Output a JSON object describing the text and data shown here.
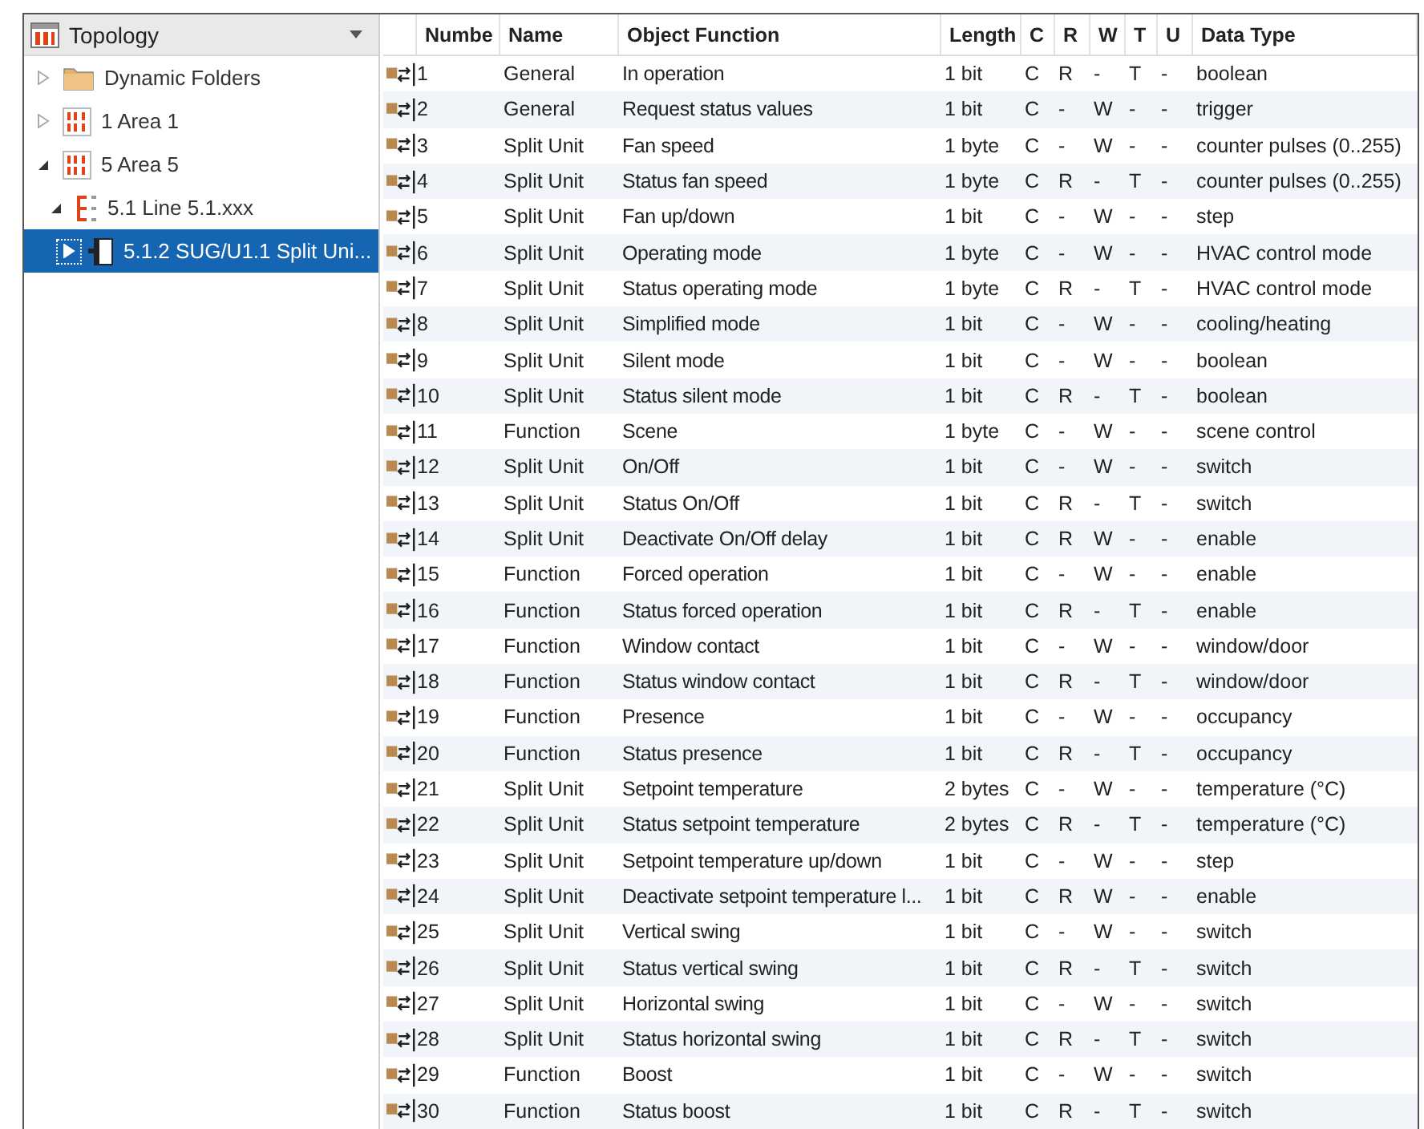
{
  "panel": {
    "title": "Topology"
  },
  "tree": [
    {
      "label": "Dynamic Folders",
      "kind": "folder",
      "expanded": false,
      "selected": false
    },
    {
      "label": "1 Area 1",
      "kind": "area",
      "expanded": false,
      "selected": false
    },
    {
      "label": "5 Area 5",
      "kind": "area",
      "expanded": true,
      "selected": false,
      "children": [
        {
          "label": "5.1 Line 5.1.xxx",
          "kind": "line",
          "expanded": true,
          "selected": false,
          "children": [
            {
              "label": "5.1.2 SUG/U1.1 Split Uni...",
              "kind": "device",
              "expanded": false,
              "selected": true
            }
          ]
        }
      ]
    }
  ],
  "table": {
    "columns": [
      "Numbe",
      "Name",
      "Object Function",
      "Length",
      "C",
      "R",
      "W",
      "T",
      "U",
      "Data Type"
    ],
    "rows": [
      {
        "number": "1",
        "name": "General",
        "object_function": "In operation",
        "length": "1 bit",
        "c": "C",
        "r": "R",
        "w": "-",
        "t": "T",
        "u": "-",
        "data_type": "boolean"
      },
      {
        "number": "2",
        "name": "General",
        "object_function": "Request status values",
        "length": "1 bit",
        "c": "C",
        "r": "-",
        "w": "W",
        "t": "-",
        "u": "-",
        "data_type": "trigger"
      },
      {
        "number": "3",
        "name": "Split Unit",
        "object_function": "Fan speed",
        "length": "1 byte",
        "c": "C",
        "r": "-",
        "w": "W",
        "t": "-",
        "u": "-",
        "data_type": "counter pulses (0..255)"
      },
      {
        "number": "4",
        "name": "Split Unit",
        "object_function": "Status fan speed",
        "length": "1 byte",
        "c": "C",
        "r": "R",
        "w": "-",
        "t": "T",
        "u": "-",
        "data_type": "counter pulses (0..255)"
      },
      {
        "number": "5",
        "name": "Split Unit",
        "object_function": "Fan up/down",
        "length": "1 bit",
        "c": "C",
        "r": "-",
        "w": "W",
        "t": "-",
        "u": "-",
        "data_type": "step"
      },
      {
        "number": "6",
        "name": "Split Unit",
        "object_function": "Operating mode",
        "length": "1 byte",
        "c": "C",
        "r": "-",
        "w": "W",
        "t": "-",
        "u": "-",
        "data_type": "HVAC control mode"
      },
      {
        "number": "7",
        "name": "Split Unit",
        "object_function": "Status operating mode",
        "length": "1 byte",
        "c": "C",
        "r": "R",
        "w": "-",
        "t": "T",
        "u": "-",
        "data_type": "HVAC control mode"
      },
      {
        "number": "8",
        "name": "Split Unit",
        "object_function": "Simplified mode",
        "length": "1 bit",
        "c": "C",
        "r": "-",
        "w": "W",
        "t": "-",
        "u": "-",
        "data_type": "cooling/heating"
      },
      {
        "number": "9",
        "name": "Split Unit",
        "object_function": "Silent mode",
        "length": "1 bit",
        "c": "C",
        "r": "-",
        "w": "W",
        "t": "-",
        "u": "-",
        "data_type": "boolean"
      },
      {
        "number": "10",
        "name": "Split Unit",
        "object_function": "Status silent mode",
        "length": "1 bit",
        "c": "C",
        "r": "R",
        "w": "-",
        "t": "T",
        "u": "-",
        "data_type": "boolean"
      },
      {
        "number": "11",
        "name": "Function",
        "object_function": "Scene",
        "length": "1 byte",
        "c": "C",
        "r": "-",
        "w": "W",
        "t": "-",
        "u": "-",
        "data_type": "scene control"
      },
      {
        "number": "12",
        "name": "Split Unit",
        "object_function": "On/Off",
        "length": "1 bit",
        "c": "C",
        "r": "-",
        "w": "W",
        "t": "-",
        "u": "-",
        "data_type": "switch"
      },
      {
        "number": "13",
        "name": "Split Unit",
        "object_function": "Status On/Off",
        "length": "1 bit",
        "c": "C",
        "r": "R",
        "w": "-",
        "t": "T",
        "u": "-",
        "data_type": "switch"
      },
      {
        "number": "14",
        "name": "Split Unit",
        "object_function": "Deactivate On/Off delay",
        "length": "1 bit",
        "c": "C",
        "r": "R",
        "w": "W",
        "t": "-",
        "u": "-",
        "data_type": "enable"
      },
      {
        "number": "15",
        "name": "Function",
        "object_function": "Forced operation",
        "length": "1 bit",
        "c": "C",
        "r": "-",
        "w": "W",
        "t": "-",
        "u": "-",
        "data_type": "enable"
      },
      {
        "number": "16",
        "name": "Function",
        "object_function": "Status forced operation",
        "length": "1 bit",
        "c": "C",
        "r": "R",
        "w": "-",
        "t": "T",
        "u": "-",
        "data_type": "enable"
      },
      {
        "number": "17",
        "name": "Function",
        "object_function": "Window contact",
        "length": "1 bit",
        "c": "C",
        "r": "-",
        "w": "W",
        "t": "-",
        "u": "-",
        "data_type": "window/door"
      },
      {
        "number": "18",
        "name": "Function",
        "object_function": "Status window contact",
        "length": "1 bit",
        "c": "C",
        "r": "R",
        "w": "-",
        "t": "T",
        "u": "-",
        "data_type": "window/door"
      },
      {
        "number": "19",
        "name": "Function",
        "object_function": "Presence",
        "length": "1 bit",
        "c": "C",
        "r": "-",
        "w": "W",
        "t": "-",
        "u": "-",
        "data_type": "occupancy"
      },
      {
        "number": "20",
        "name": "Function",
        "object_function": "Status presence",
        "length": "1 bit",
        "c": "C",
        "r": "R",
        "w": "-",
        "t": "T",
        "u": "-",
        "data_type": "occupancy"
      },
      {
        "number": "21",
        "name": "Split Unit",
        "object_function": "Setpoint temperature",
        "length": "2 bytes",
        "c": "C",
        "r": "-",
        "w": "W",
        "t": "-",
        "u": "-",
        "data_type": "temperature (°C)"
      },
      {
        "number": "22",
        "name": "Split Unit",
        "object_function": "Status setpoint temperature",
        "length": "2 bytes",
        "c": "C",
        "r": "R",
        "w": "-",
        "t": "T",
        "u": "-",
        "data_type": "temperature (°C)"
      },
      {
        "number": "23",
        "name": "Split Unit",
        "object_function": "Setpoint temperature up/down",
        "length": "1 bit",
        "c": "C",
        "r": "-",
        "w": "W",
        "t": "-",
        "u": "-",
        "data_type": "step"
      },
      {
        "number": "24",
        "name": "Split Unit",
        "object_function": "Deactivate setpoint temperature l...",
        "length": "1 bit",
        "c": "C",
        "r": "R",
        "w": "W",
        "t": "-",
        "u": "-",
        "data_type": "enable"
      },
      {
        "number": "25",
        "name": "Split Unit",
        "object_function": "Vertical swing",
        "length": "1 bit",
        "c": "C",
        "r": "-",
        "w": "W",
        "t": "-",
        "u": "-",
        "data_type": "switch"
      },
      {
        "number": "26",
        "name": "Split Unit",
        "object_function": "Status vertical swing",
        "length": "1 bit",
        "c": "C",
        "r": "R",
        "w": "-",
        "t": "T",
        "u": "-",
        "data_type": "switch"
      },
      {
        "number": "27",
        "name": "Split Unit",
        "object_function": "Horizontal swing",
        "length": "1 bit",
        "c": "C",
        "r": "-",
        "w": "W",
        "t": "-",
        "u": "-",
        "data_type": "switch"
      },
      {
        "number": "28",
        "name": "Split Unit",
        "object_function": "Status horizontal swing",
        "length": "1 bit",
        "c": "C",
        "r": "R",
        "w": "-",
        "t": "T",
        "u": "-",
        "data_type": "switch"
      },
      {
        "number": "29",
        "name": "Function",
        "object_function": "Boost",
        "length": "1 bit",
        "c": "C",
        "r": "-",
        "w": "W",
        "t": "-",
        "u": "-",
        "data_type": "switch"
      },
      {
        "number": "30",
        "name": "Function",
        "object_function": "Status boost",
        "length": "1 bit",
        "c": "C",
        "r": "R",
        "w": "-",
        "t": "T",
        "u": "-",
        "data_type": "switch"
      }
    ]
  }
}
